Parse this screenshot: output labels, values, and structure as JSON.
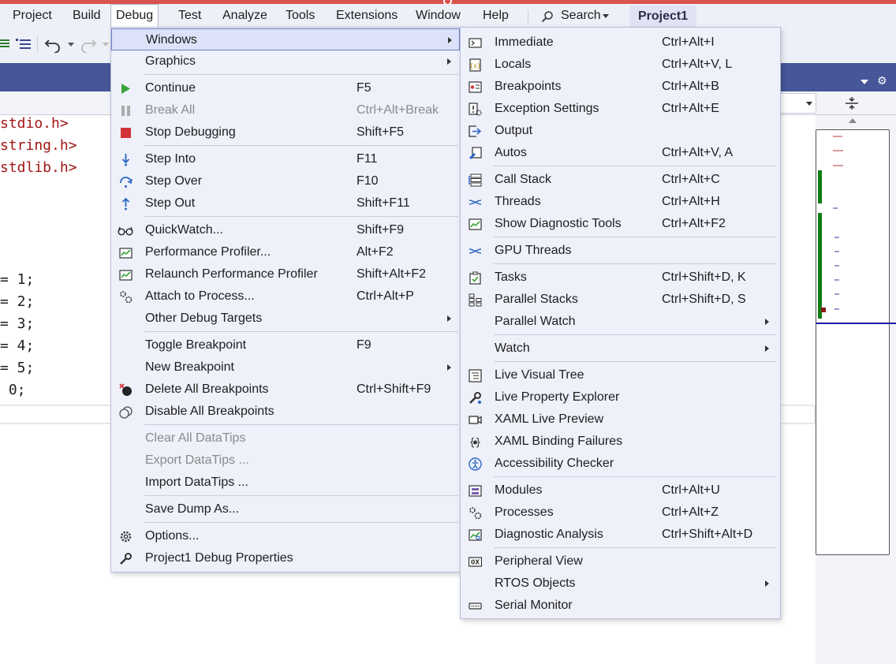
{
  "menubar": {
    "items": [
      "Project",
      "Build",
      "Debug",
      "Test",
      "Analyze",
      "Tools",
      "Extensions",
      "Window",
      "Help"
    ],
    "search_label": "Search",
    "project_name": "Project1"
  },
  "code": {
    "lines": [
      "stdio.h>",
      "string.h>",
      "stdlib.h>",
      "= 1;",
      "= 2;",
      "= 3;",
      "= 4;",
      "= 5;",
      " 0;"
    ]
  },
  "debug_menu": {
    "items": [
      {
        "label": "Windows",
        "shortcut": "",
        "submenu": true
      },
      {
        "label": "Graphics",
        "shortcut": "",
        "submenu": true
      },
      {
        "label": "Continue",
        "shortcut": "F5"
      },
      {
        "label": "Break All",
        "shortcut": "Ctrl+Alt+Break",
        "disabled": true
      },
      {
        "label": "Stop Debugging",
        "shortcut": "Shift+F5"
      },
      {
        "label": "Step Into",
        "shortcut": "F11"
      },
      {
        "label": "Step Over",
        "shortcut": "F10"
      },
      {
        "label": "Step Out",
        "shortcut": "Shift+F11"
      },
      {
        "label": "QuickWatch...",
        "shortcut": "Shift+F9"
      },
      {
        "label": "Performance Profiler...",
        "shortcut": "Alt+F2"
      },
      {
        "label": "Relaunch Performance Profiler",
        "shortcut": "Shift+Alt+F2"
      },
      {
        "label": "Attach to Process...",
        "shortcut": "Ctrl+Alt+P"
      },
      {
        "label": "Other Debug Targets",
        "shortcut": "",
        "submenu": true
      },
      {
        "label": "Toggle Breakpoint",
        "shortcut": "F9"
      },
      {
        "label": "New Breakpoint",
        "shortcut": "",
        "submenu": true
      },
      {
        "label": "Delete All Breakpoints",
        "shortcut": "Ctrl+Shift+F9"
      },
      {
        "label": "Disable All Breakpoints",
        "shortcut": ""
      },
      {
        "label": "Clear All DataTips",
        "shortcut": "",
        "disabled": true
      },
      {
        "label": "Export DataTips ...",
        "shortcut": "",
        "disabled": true
      },
      {
        "label": "Import DataTips ...",
        "shortcut": ""
      },
      {
        "label": "Save Dump As...",
        "shortcut": ""
      },
      {
        "label": "Options...",
        "shortcut": ""
      },
      {
        "label": "Project1 Debug Properties",
        "shortcut": ""
      }
    ]
  },
  "windows_menu": {
    "items": [
      {
        "label": "Immediate",
        "shortcut": "Ctrl+Alt+I"
      },
      {
        "label": "Locals",
        "shortcut": "Ctrl+Alt+V, L"
      },
      {
        "label": "Breakpoints",
        "shortcut": "Ctrl+Alt+B"
      },
      {
        "label": "Exception Settings",
        "shortcut": "Ctrl+Alt+E"
      },
      {
        "label": "Output",
        "shortcut": ""
      },
      {
        "label": "Autos",
        "shortcut": "Ctrl+Alt+V, A"
      },
      {
        "label": "Call Stack",
        "shortcut": "Ctrl+Alt+C"
      },
      {
        "label": "Threads",
        "shortcut": "Ctrl+Alt+H"
      },
      {
        "label": "Show Diagnostic Tools",
        "shortcut": "Ctrl+Alt+F2"
      },
      {
        "label": "GPU Threads",
        "shortcut": ""
      },
      {
        "label": "Tasks",
        "shortcut": "Ctrl+Shift+D, K"
      },
      {
        "label": "Parallel Stacks",
        "shortcut": "Ctrl+Shift+D, S"
      },
      {
        "label": "Parallel Watch",
        "shortcut": "",
        "submenu": true
      },
      {
        "label": "Watch",
        "shortcut": "",
        "submenu": true
      },
      {
        "label": "Live Visual Tree",
        "shortcut": ""
      },
      {
        "label": "Live Property Explorer",
        "shortcut": ""
      },
      {
        "label": "XAML Live Preview",
        "shortcut": ""
      },
      {
        "label": "XAML Binding Failures",
        "shortcut": ""
      },
      {
        "label": "Accessibility Checker",
        "shortcut": ""
      },
      {
        "label": "Modules",
        "shortcut": "Ctrl+Alt+U"
      },
      {
        "label": "Processes",
        "shortcut": "Ctrl+Alt+Z"
      },
      {
        "label": "Diagnostic Analysis",
        "shortcut": "Ctrl+Shift+Alt+D"
      },
      {
        "label": "Peripheral View",
        "shortcut": ""
      },
      {
        "label": "RTOS Objects",
        "shortcut": "",
        "submenu": true
      },
      {
        "label": "Serial Monitor",
        "shortcut": ""
      }
    ]
  },
  "colors": {
    "accent": "#465698",
    "menu_bg": "#eef0fa",
    "highlight": "#dce2f9",
    "include_text": "#a31515",
    "continue_green": "#3aa33a",
    "stop_red": "#d13438"
  }
}
